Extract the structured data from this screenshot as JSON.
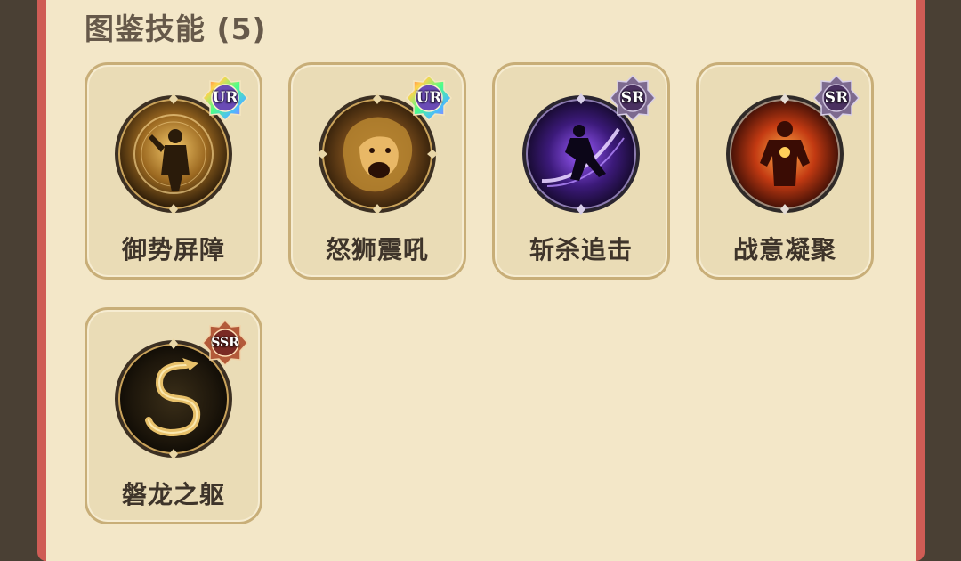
{
  "section": {
    "title": "图鉴技能 (5)"
  },
  "skills": [
    {
      "name": "御势屏障",
      "rarity": "UR",
      "icon": "golden-warrior-barrier-icon"
    },
    {
      "name": "怒狮震吼",
      "rarity": "UR",
      "icon": "roaring-lion-icon"
    },
    {
      "name": "斩杀追击",
      "rarity": "SR",
      "icon": "purple-slash-assassin-icon"
    },
    {
      "name": "战意凝聚",
      "rarity": "SR",
      "icon": "fire-warrior-icon"
    },
    {
      "name": "磐龙之躯",
      "rarity": "SSR",
      "icon": "golden-dragon-icon"
    }
  ],
  "colors": {
    "panel_bg": "#f3e7c8",
    "panel_border": "#cf5c55",
    "card_bg": "#eadcb6",
    "card_border": "#c8ae78",
    "ur_badge": "rainbow",
    "sr_badge": "#4a3060",
    "ssr_badge": "#7a2a24"
  }
}
